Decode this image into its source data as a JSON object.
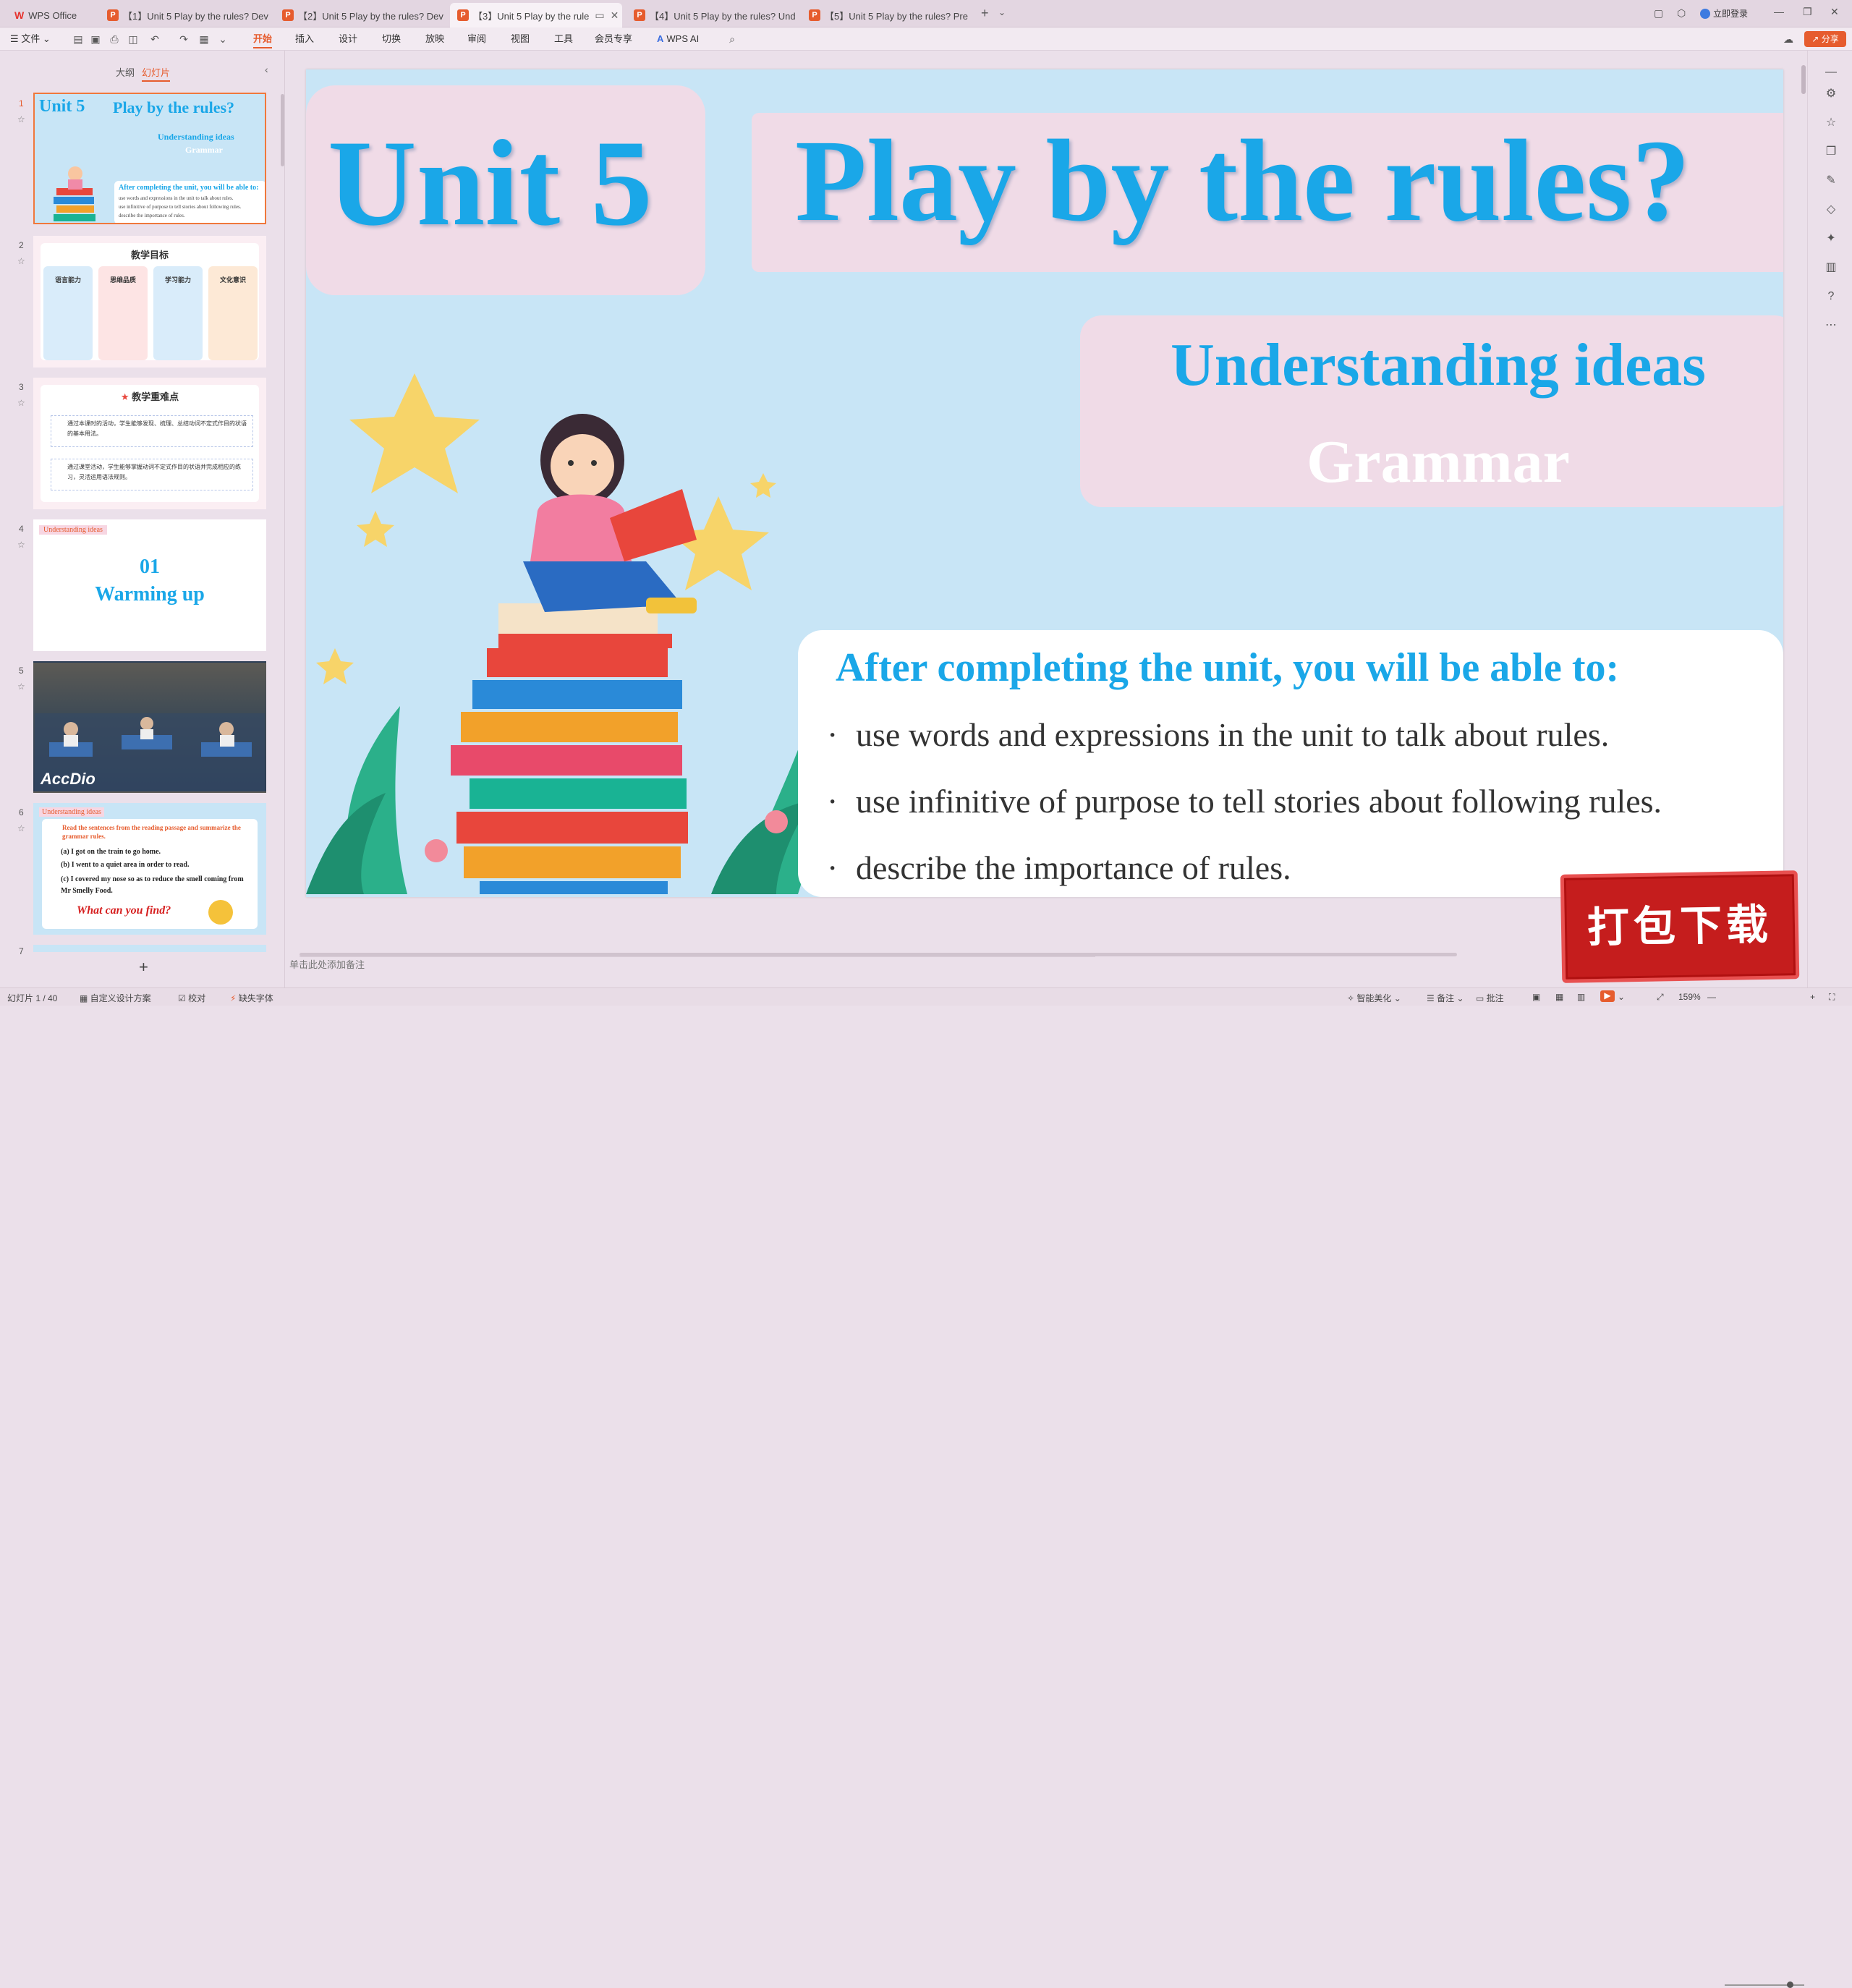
{
  "tabs": [
    {
      "label": "WPS Office",
      "type": "home"
    },
    {
      "label": "【1】Unit 5 Play by the rules? Dev",
      "type": "ppt"
    },
    {
      "label": "【2】Unit 5 Play by the rules? Dev",
      "type": "ppt"
    },
    {
      "label": "【3】Unit 5 Play by the rule",
      "type": "ppt",
      "active": true
    },
    {
      "label": "【4】Unit 5 Play by the rules? Und",
      "type": "ppt"
    },
    {
      "label": "【5】Unit 5 Play by the rules? Pre",
      "type": "ppt"
    }
  ],
  "titlebar": {
    "login": "立即登录",
    "share": "分享"
  },
  "menubar": {
    "file": "文件",
    "items": [
      "开始",
      "插入",
      "设计",
      "切换",
      "放映",
      "审阅",
      "视图",
      "工具",
      "会员专享",
      "WPS AI"
    ],
    "active": "开始"
  },
  "leftpanel": {
    "tabs": [
      "大纲",
      "幻灯片"
    ],
    "active_tab": "幻灯片",
    "thumbnails": [
      {
        "num": "1",
        "title1": "Unit 5",
        "title2": "Play by the rules?",
        "sub1": "Understanding ideas",
        "sub2": "Grammar",
        "line": "After completing the unit, you will be able to:",
        "b1": "use words and expressions in the unit to talk about rules.",
        "b2": "use infinitive of purpose to tell stories about following rules.",
        "b3": "describe the importance of rules."
      },
      {
        "num": "2",
        "head": "教学目标",
        "cols": [
          "语言能力",
          "思维品质",
          "学习能力",
          "文化意识"
        ]
      },
      {
        "num": "3",
        "head": "教学重难点",
        "p1": "通过本课时的活动，学生能够发现、梳理、总结动词不定式作目的状语的基本用法。",
        "p2": "通过课堂活动，学生能够掌握动词不定式作目的状语并完成相应的练习，灵活运用语法规则。"
      },
      {
        "num": "4",
        "tag": "Understanding ideas",
        "l1": "01",
        "l2": "Warming up"
      },
      {
        "num": "5",
        "caption": "AccDio"
      },
      {
        "num": "6",
        "tag": "Understanding ideas",
        "instr": "Read the sentences from the reading passage and summarize the grammar rules.",
        "a": "(a)  I got on the train to go home.",
        "b": "(b)  I went to a quiet area in order to read.",
        "c": "(c)  I covered my nose so as to reduce the smell coming from Mr Smelly Food.",
        "q": "What can you find?"
      },
      {
        "num": "7"
      }
    ]
  },
  "slide": {
    "unit": "Unit 5",
    "title": "Play by the rules?",
    "sub1": "Understanding ideas",
    "sub2": "Grammar",
    "objective": "After completing the unit, you will be able to:",
    "bullets": [
      "use words and expressions in the unit to talk about rules.",
      "use infinitive of purpose to tell stories about following rules.",
      "describe the importance of rules."
    ],
    "bullet_marker": "·"
  },
  "notes_placeholder": "单击此处添加备注",
  "statusbar": {
    "slide_info": "幻灯片 1 / 40",
    "design": "自定义设计方案",
    "proof": "校对",
    "missing_font": "缺失字体",
    "smart": "智能美化",
    "notes": "备注",
    "comments": "批注",
    "zoom": "159%"
  },
  "stamp": "打包下载",
  "colors": {
    "accent": "#e65c2e",
    "title_blue": "#1aa7e8",
    "slide_bg": "#c8e5f6",
    "pink_box": "#f0dbe7"
  }
}
